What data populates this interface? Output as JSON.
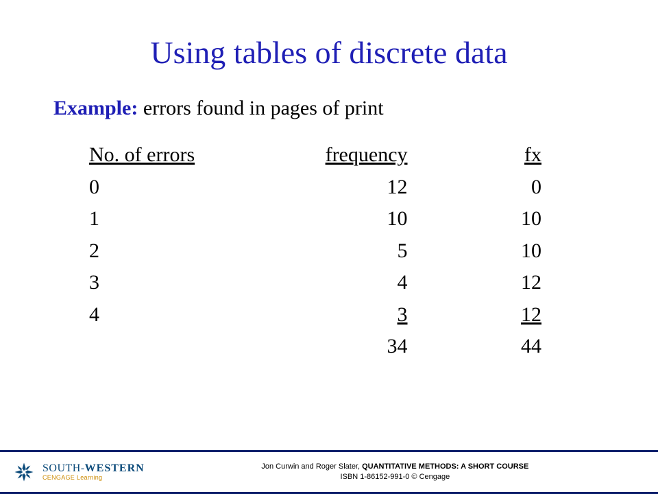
{
  "title": "Using  tables of discrete data",
  "example": {
    "label": "Example:",
    "desc": "  errors found in pages of print"
  },
  "table": {
    "headers": {
      "c1": "No. of errors",
      "c2": "frequency",
      "c3": "fx"
    },
    "rows": [
      {
        "c1": "0",
        "c2": "12",
        "c3": "0"
      },
      {
        "c1": "1",
        "c2": "10",
        "c3": "10"
      },
      {
        "c1": "2",
        "c2": "5",
        "c3": "10"
      },
      {
        "c1": "3",
        "c2": "4",
        "c3": "12"
      },
      {
        "c1": "4",
        "c2": "3",
        "c3": "12"
      }
    ],
    "totals": {
      "c2": "34",
      "c3": "44"
    }
  },
  "footer": {
    "brand_a": "SOUTH-",
    "brand_b": "WESTERN",
    "brand_sub": "CENGAGE Learning",
    "credit_authors": "Jon Curwin and Roger Slater, ",
    "credit_title": "QUANTITATIVE METHODS: A SHORT COURSE",
    "credit_isbn": "ISBN 1-86152-991-0    © Cengage"
  }
}
